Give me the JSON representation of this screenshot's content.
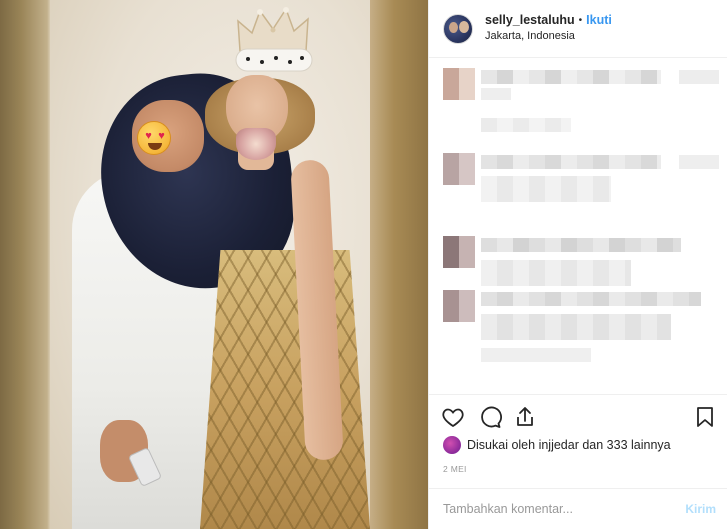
{
  "post": {
    "username": "selly_lestaluhu",
    "separator": "•",
    "follow_label": "Ikuti",
    "location": "Jakarta, Indonesia"
  },
  "actions": {
    "like_icon": "heart-icon",
    "comment_icon": "comment-icon",
    "share_icon": "share-icon",
    "save_icon": "bookmark-icon"
  },
  "likes": {
    "text": "Disukai oleh injjedar dan 333 lainnya"
  },
  "date": "2 MEI",
  "comment_box": {
    "placeholder": "Tambahkan komentar...",
    "send_label": "Kirim"
  },
  "colors": {
    "link_blue": "#3897f0",
    "send_disabled": "#b2dffc",
    "border": "#efefef"
  }
}
